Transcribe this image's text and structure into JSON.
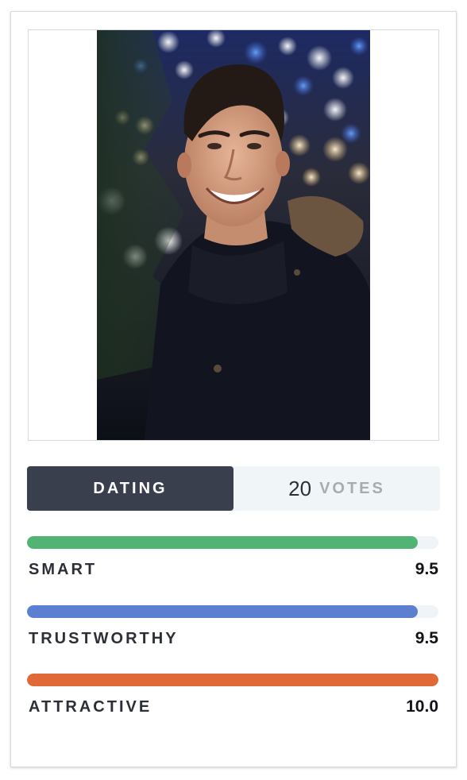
{
  "profile": {
    "photo_alt": "Smiling young man with dark hair wearing a dark coat in front of a Christmas tree with bokeh lights"
  },
  "category": {
    "label": "DATING",
    "votes_count": "20",
    "votes_label": "VOTES"
  },
  "metrics": [
    {
      "label": "SMART",
      "value": "9.5",
      "score": 9.5,
      "color": "#52b474"
    },
    {
      "label": "TRUSTWORTHY",
      "value": "9.5",
      "score": 9.5,
      "color": "#5c7fd1"
    },
    {
      "label": "ATTRACTIVE",
      "value": "10.0",
      "score": 10.0,
      "color": "#e06a37"
    }
  ],
  "score_max": 10
}
